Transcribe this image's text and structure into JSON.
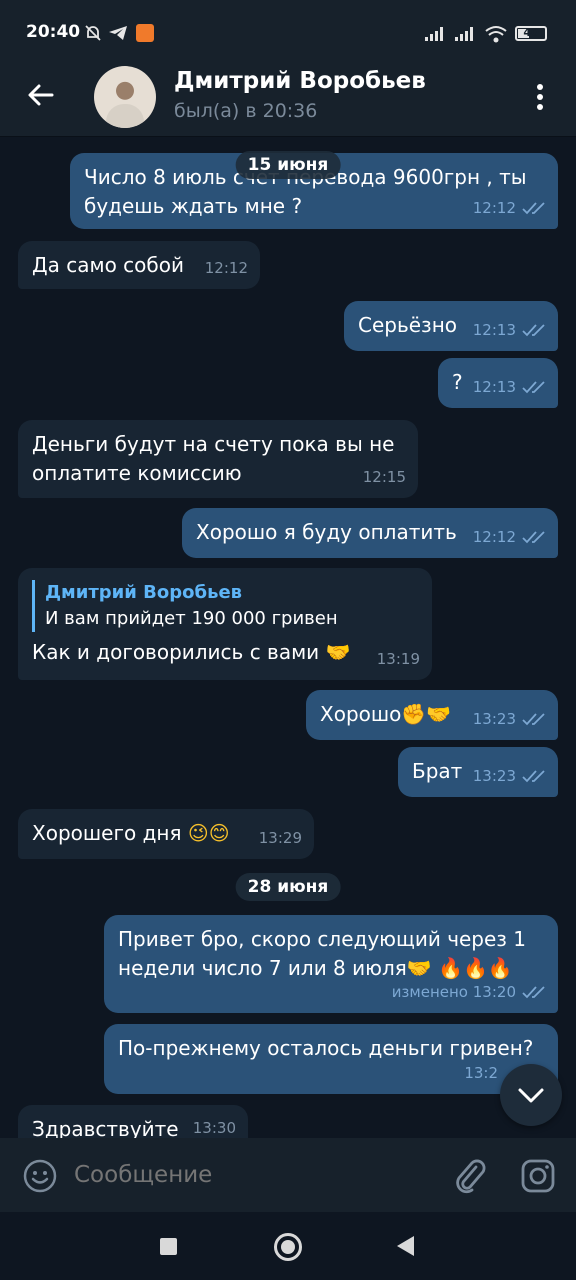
{
  "status_bar": {
    "time": "20:40",
    "battery": "40",
    "icons": [
      "mute-bell-icon",
      "telegram-icon",
      "app-notification-icon",
      "signal-icon",
      "signal-icon",
      "wifi-icon",
      "battery-icon"
    ]
  },
  "header": {
    "name": "Дмитрий Воробьев",
    "status": "был(а) в 20:36"
  },
  "chat": {
    "dates": [
      "15 июня",
      "28 июня"
    ],
    "messages": [
      {
        "dir": "out",
        "text": "Число 8 июль счёт перевода 9600грн , ты будешь ждать мне ?",
        "time": "12:12",
        "read": true
      },
      {
        "dir": "in",
        "text": "Да само собой",
        "time": "12:12"
      },
      {
        "dir": "out",
        "text": "Серьёзно",
        "time": "12:13",
        "read": true
      },
      {
        "dir": "out",
        "text": "?",
        "time": "12:13",
        "read": true
      },
      {
        "dir": "in",
        "text": "Деньги будут на счету пока вы не оплатите комиссию",
        "time": "12:15"
      },
      {
        "dir": "out",
        "text": "Хорошо я буду оплатить",
        "time": "12:12",
        "read": true
      },
      {
        "dir": "in",
        "reply_name": "Дмитрий Воробьев",
        "reply_text": "И вам прийдет 190 000 гривен",
        "text": "Как и договорились с вами",
        "emoji": "🤝",
        "time": "13:19"
      },
      {
        "dir": "out",
        "text": "Хорошо",
        "emoji": "✊🤝",
        "time": "13:23",
        "read": true
      },
      {
        "dir": "out",
        "text": "Брат",
        "time": "13:23",
        "read": true
      },
      {
        "dir": "in",
        "text": "Хорошего дня",
        "emoji": "😉😊",
        "time": "13:29"
      },
      {
        "dir": "out",
        "text": "Привет бро, скоро следующий через 1 недели число 7 или 8 июля",
        "emoji": "🤝 🔥🔥🔥",
        "edited": "изменено",
        "time": "13:20",
        "read": true
      },
      {
        "dir": "out",
        "text": "По-прежнему осталось деньги гривен?",
        "time": "13:2"
      },
      {
        "dir": "in",
        "text": "Здравствуйте",
        "time": "13:30"
      }
    ]
  },
  "input": {
    "placeholder": "Сообщение"
  },
  "colors": {
    "background": "#0e1621",
    "bar": "#17212b",
    "incoming": "#182533",
    "outgoing": "#2b5278",
    "accent": "#5eb5f7"
  }
}
